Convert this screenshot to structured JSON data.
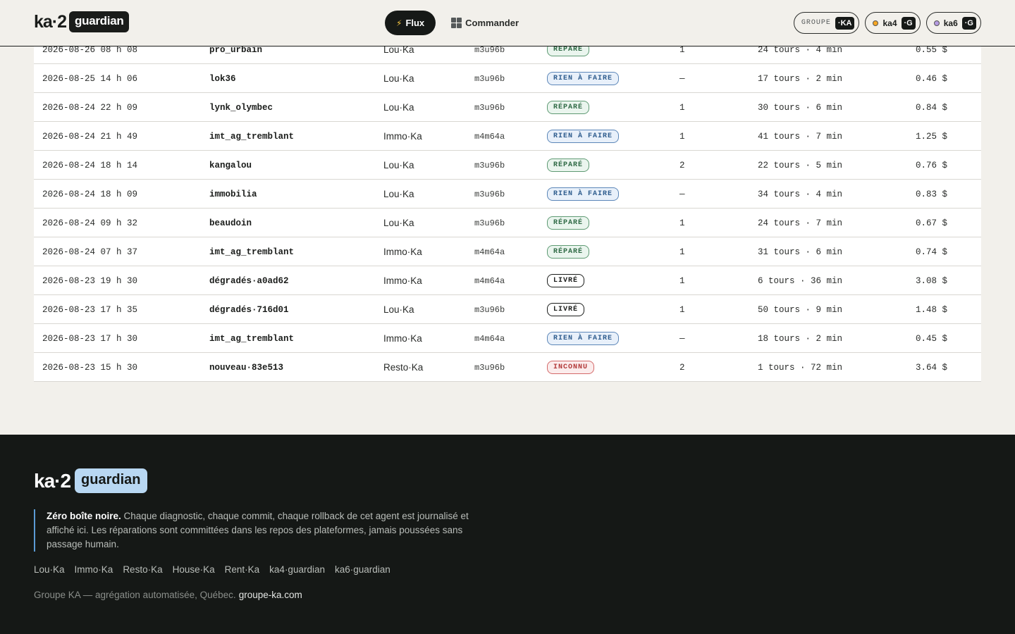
{
  "header": {
    "logo_text": "ka·2",
    "logo_badge": "guardian",
    "nav": {
      "flux_icon": "⚡",
      "flux_label": "Flux",
      "commander_label": "Commander"
    },
    "pills": [
      {
        "label": "GROUPE",
        "tag": "·KA"
      },
      {
        "label": "ka4",
        "tag": "·G",
        "dot_color": "#f5a623"
      },
      {
        "label": "ka6",
        "tag": "·G",
        "dot_color": "#b59be0"
      }
    ]
  },
  "rows": [
    {
      "date": "2026-08-26 08 h 08",
      "name": "pro_urbain",
      "platform": "Lou·Ka",
      "agent": "m3u96b",
      "status": "RÉPARÉ",
      "status_kind": "repare",
      "n": "1",
      "tours": "24 tours · 4 min",
      "cost": "0.55 $"
    },
    {
      "date": "2026-08-25 14 h 06",
      "name": "lok36",
      "platform": "Lou·Ka",
      "agent": "m3u96b",
      "status": "RIEN À FAIRE",
      "status_kind": "rien",
      "n": "—",
      "tours": "17 tours · 2 min",
      "cost": "0.46 $"
    },
    {
      "date": "2026-08-24 22 h 09",
      "name": "lynk_olymbec",
      "platform": "Lou·Ka",
      "agent": "m3u96b",
      "status": "RÉPARÉ",
      "status_kind": "repare",
      "n": "1",
      "tours": "30 tours · 6 min",
      "cost": "0.84 $"
    },
    {
      "date": "2026-08-24 21 h 49",
      "name": "imt_ag_tremblant",
      "platform": "Immo·Ka",
      "agent": "m4m64a",
      "status": "RIEN À FAIRE",
      "status_kind": "rien",
      "n": "1",
      "tours": "41 tours · 7 min",
      "cost": "1.25 $"
    },
    {
      "date": "2026-08-24 18 h 14",
      "name": "kangalou",
      "platform": "Lou·Ka",
      "agent": "m3u96b",
      "status": "RÉPARÉ",
      "status_kind": "repare",
      "n": "2",
      "tours": "22 tours · 5 min",
      "cost": "0.76 $"
    },
    {
      "date": "2026-08-24 18 h 09",
      "name": "immobilia",
      "platform": "Lou·Ka",
      "agent": "m3u96b",
      "status": "RIEN À FAIRE",
      "status_kind": "rien",
      "n": "—",
      "tours": "34 tours · 4 min",
      "cost": "0.83 $"
    },
    {
      "date": "2026-08-24 09 h 32",
      "name": "beaudoin",
      "platform": "Lou·Ka",
      "agent": "m3u96b",
      "status": "RÉPARÉ",
      "status_kind": "repare",
      "n": "1",
      "tours": "24 tours · 7 min",
      "cost": "0.67 $"
    },
    {
      "date": "2026-08-24 07 h 37",
      "name": "imt_ag_tremblant",
      "platform": "Immo·Ka",
      "agent": "m4m64a",
      "status": "RÉPARÉ",
      "status_kind": "repare",
      "n": "1",
      "tours": "31 tours · 6 min",
      "cost": "0.74 $"
    },
    {
      "date": "2026-08-23 19 h 30",
      "name": "dégradés·a0ad62",
      "platform": "Immo·Ka",
      "agent": "m4m64a",
      "status": "LIVRÉ",
      "status_kind": "livre",
      "n": "1",
      "tours": "6 tours · 36 min",
      "cost": "3.08 $"
    },
    {
      "date": "2026-08-23 17 h 35",
      "name": "dégradés·716d01",
      "platform": "Lou·Ka",
      "agent": "m3u96b",
      "status": "LIVRÉ",
      "status_kind": "livre",
      "n": "1",
      "tours": "50 tours · 9 min",
      "cost": "1.48 $"
    },
    {
      "date": "2026-08-23 17 h 30",
      "name": "imt_ag_tremblant",
      "platform": "Immo·Ka",
      "agent": "m4m64a",
      "status": "RIEN À FAIRE",
      "status_kind": "rien",
      "n": "—",
      "tours": "18 tours · 2 min",
      "cost": "0.45 $"
    },
    {
      "date": "2026-08-23 15 h 30",
      "name": "nouveau·83e513",
      "platform": "Resto·Ka",
      "agent": "m3u96b",
      "status": "INCONNU",
      "status_kind": "inconnu",
      "n": "2",
      "tours": "1 tours · 72 min",
      "cost": "3.64 $"
    }
  ],
  "footer": {
    "logo_text": "ka·2",
    "logo_badge": "guardian",
    "quote_bold": "Zéro boîte noire.",
    "quote_text": " Chaque diagnostic, chaque commit, chaque rollback de cet agent est journalisé et affiché ici. Les réparations sont committées dans les repos des plateformes, jamais poussées sans passage humain.",
    "links": [
      "Lou·Ka",
      "Immo·Ka",
      "Resto·Ka",
      "House·Ka",
      "Rent·Ka",
      "ka4·guardian",
      "ka6·guardian"
    ],
    "bottom_text": "Groupe KA — agrégation automatisée, Québec.",
    "bottom_link": "groupe-ka.com"
  }
}
